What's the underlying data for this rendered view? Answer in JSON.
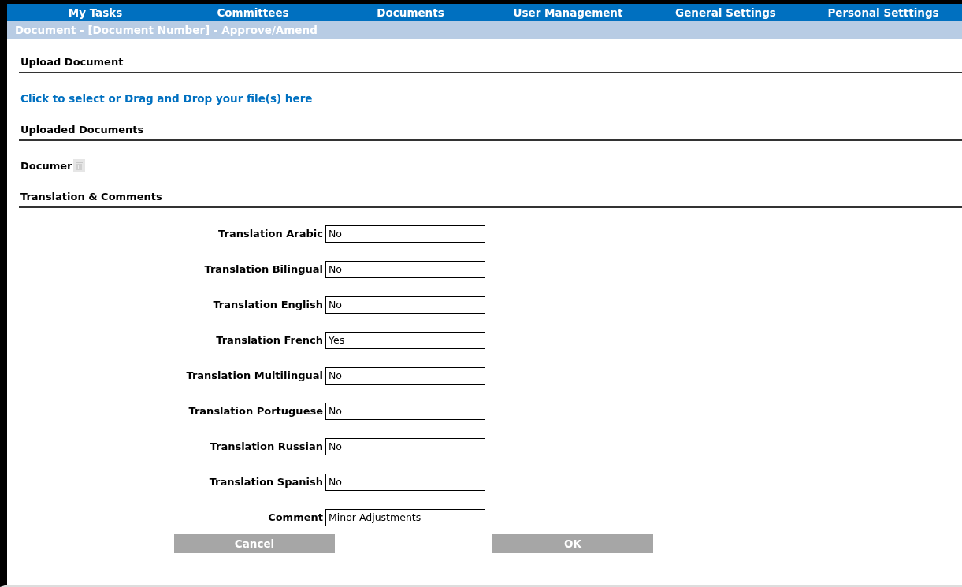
{
  "nav": [
    {
      "label": "My Tasks"
    },
    {
      "label": "Committees"
    },
    {
      "label": "Documents"
    },
    {
      "label": "User Management"
    },
    {
      "label": "General Settings"
    },
    {
      "label": "Personal Setttings"
    }
  ],
  "page_title": "Document - [Document Number] - Approve/Amend",
  "upload_section": {
    "heading": "Upload Document",
    "dropzone_link": "Click to select or Drag and Drop your file(s) here"
  },
  "uploaded_section": {
    "heading": "Uploaded Documents",
    "documents": [
      {
        "name": "Documer"
      }
    ]
  },
  "translation_section": {
    "heading": "Translation & Comments",
    "fields": [
      {
        "label": "Translation Arabic",
        "value": "No"
      },
      {
        "label": "Translation Bilingual",
        "value": "No"
      },
      {
        "label": "Translation English",
        "value": "No"
      },
      {
        "label": "Translation French",
        "value": "Yes"
      },
      {
        "label": "Translation Multilingual",
        "value": "No"
      },
      {
        "label": "Translation Portuguese",
        "value": "No"
      },
      {
        "label": "Translation Russian",
        "value": "No"
      },
      {
        "label": "Translation Spanish",
        "value": "No"
      },
      {
        "label": "Comment",
        "value": "Minor Adjustments"
      }
    ]
  },
  "buttons": [
    {
      "label": "Cancel"
    },
    {
      "label": "OK"
    }
  ]
}
